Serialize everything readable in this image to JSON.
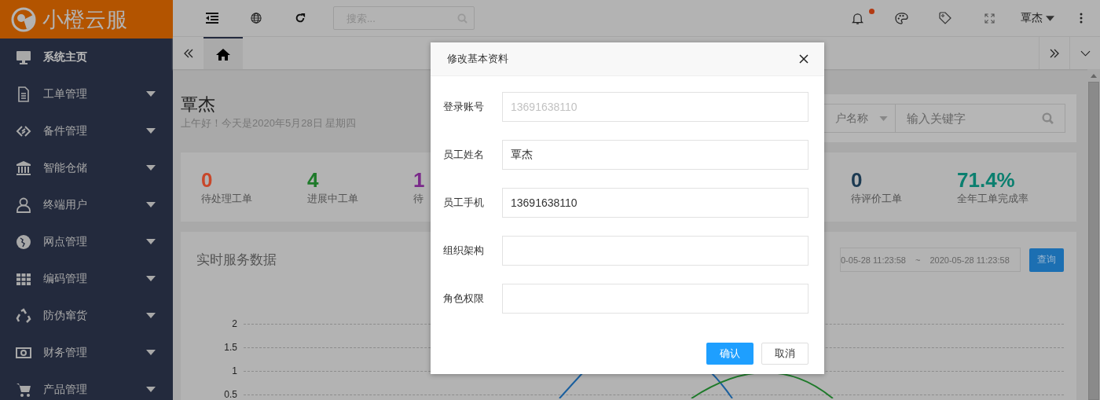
{
  "logo": {
    "text": "小橙云服"
  },
  "sidebar": {
    "items": [
      {
        "label": "系统主页",
        "expandable": false,
        "selected": true
      },
      {
        "label": "工单管理",
        "expandable": true,
        "selected": false
      },
      {
        "label": "备件管理",
        "expandable": true,
        "selected": false
      },
      {
        "label": "智能仓储",
        "expandable": true,
        "selected": false
      },
      {
        "label": "终端用户",
        "expandable": true,
        "selected": false
      },
      {
        "label": "网点管理",
        "expandable": true,
        "selected": false
      },
      {
        "label": "编码管理",
        "expandable": true,
        "selected": false
      },
      {
        "label": "防伪窜货",
        "expandable": true,
        "selected": false
      },
      {
        "label": "财务管理",
        "expandable": true,
        "selected": false
      },
      {
        "label": "产品管理",
        "expandable": true,
        "selected": false
      }
    ]
  },
  "topbar": {
    "search": {
      "placeholder": "搜索..."
    },
    "notification_dot": true,
    "user": "覃杰"
  },
  "tabs": [
    {
      "kind": "home",
      "selected": true
    }
  ],
  "header": {
    "name": "覃杰",
    "greeting": "上午好！今天是2020年5月28日 星期四"
  },
  "filter": {
    "select": "户名称",
    "search_placeholder": "输入关键字"
  },
  "stats_left": [
    {
      "value": "0",
      "label": "待处理工单",
      "color": "#c8472a"
    },
    {
      "value": "4",
      "label": "进展中工单",
      "color": "#1e7a2a"
    },
    {
      "value": "1",
      "label": "待",
      "color": "#7a2a8a"
    }
  ],
  "stats_right": [
    {
      "value": "0",
      "label": "待评价工单",
      "color": "#1c3a52"
    },
    {
      "value": "71.4%",
      "label": "全年工单完成率",
      "color": "#0b7f6f"
    }
  ],
  "chart": {
    "title": "实时服务数据",
    "date_from": "0-05-28 11:23:58",
    "separator": "~",
    "date_to": "2020-05-28 11:23:58",
    "query_button": "查询",
    "y_tick_labels": [
      "2",
      "1.5",
      "1",
      "0.5"
    ]
  },
  "dialog": {
    "title": "修改基本资料",
    "fields": [
      {
        "label": "登录账号",
        "placeholder": "13691638110"
      },
      {
        "label": "员工姓名",
        "value": "覃杰"
      },
      {
        "label": "员工手机",
        "value": "13691638110"
      },
      {
        "label": "组织架构"
      },
      {
        "label": "角色权限"
      }
    ],
    "confirm": "确认",
    "cancel": "取消"
  }
}
